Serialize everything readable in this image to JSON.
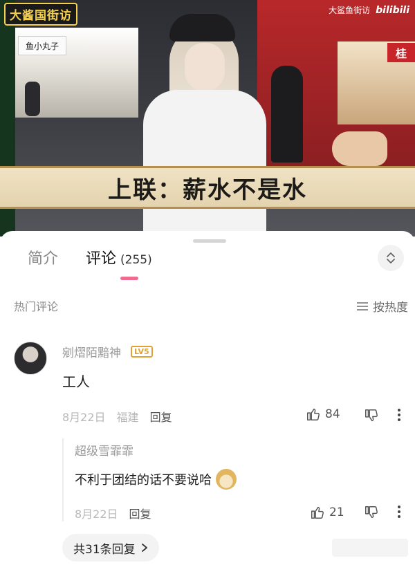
{
  "video": {
    "top_left_badge": "大酱国街访",
    "top_right_label": "大鲨鱼街访",
    "top_right_brand": "bilibili",
    "shop_sign_left": "鱼小丸子",
    "shop_sign_right": "桂",
    "caption": "上联：薪水不是水"
  },
  "tabs": [
    {
      "label": "简介",
      "active": false
    },
    {
      "label": "评论",
      "active": true,
      "count": "(255)"
    }
  ],
  "section": {
    "title": "热门评论",
    "sort_label": "按热度"
  },
  "comment": {
    "username": "剜熠陌黯神",
    "level": "LV5",
    "text": "工人",
    "date": "8月22日",
    "location": "福建",
    "reply_label": "回复",
    "likes": "84"
  },
  "reply": {
    "username": "超级雪霏霏",
    "text": "不利于团结的话不要说哈",
    "emoji": "doge-emoji",
    "date": "8月22日",
    "reply_label": "回复",
    "likes": "21"
  },
  "more_replies": {
    "label": "共31条回复",
    "chevron": "chevron-right-icon"
  },
  "colors": {
    "accent_pink": "#f06c8f",
    "level_badge": "#e2a135",
    "caption_bg": "#efe2c4"
  }
}
